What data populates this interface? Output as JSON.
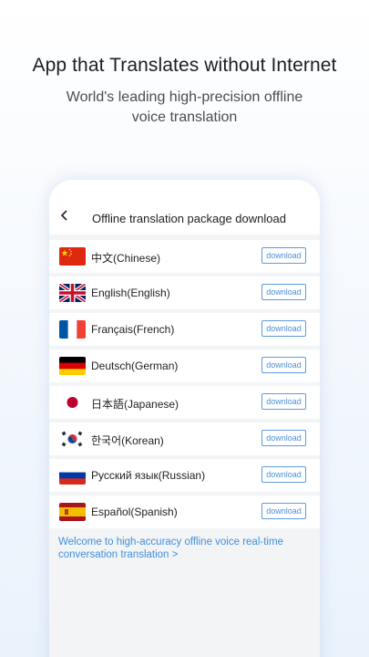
{
  "headline": "App that Translates without Internet",
  "subline": {
    "line1": "World's leading high-precision offline",
    "line2": "voice translation"
  },
  "screen": {
    "title": "Offline translation package download",
    "back_icon": "chevron-left-icon",
    "languages": [
      {
        "label": "中文(Chinese)",
        "button": "download",
        "flag": "china-flag-icon"
      },
      {
        "label": "English(English)",
        "button": "download",
        "flag": "uk-flag-icon"
      },
      {
        "label": "Français(French)",
        "button": "download",
        "flag": "france-flag-icon"
      },
      {
        "label": "Deutsch(German)",
        "button": "download",
        "flag": "germany-flag-icon"
      },
      {
        "label": "日本語(Japanese)",
        "button": "download",
        "flag": "japan-flag-icon"
      },
      {
        "label": "한국어(Korean)",
        "button": "download",
        "flag": "korea-flag-icon"
      },
      {
        "label": "Русский язык(Russian)",
        "button": "download",
        "flag": "russia-flag-icon"
      },
      {
        "label": "Español(Spanish)",
        "button": "download",
        "flag": "spain-flag-icon"
      }
    ],
    "footer_link": "Welcome to high-accuracy offline voice real-time conversation translation >"
  },
  "colors": {
    "accent": "#4a8fd8",
    "link": "#3f8fdc",
    "list_background": "#f3f4f6"
  }
}
